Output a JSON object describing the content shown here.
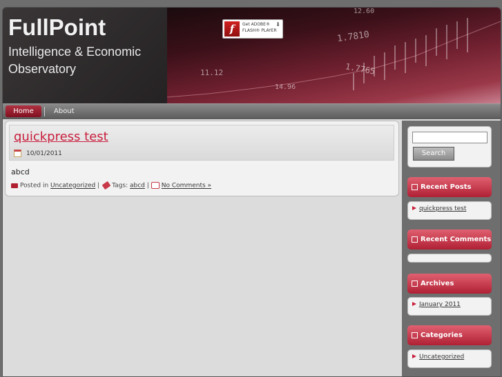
{
  "header": {
    "site_title": "FullPoint",
    "site_description": "Intelligence & Economic Observatory",
    "flash_badge": {
      "line1": "Get ADOBE®",
      "line2": "FLASH® PLAYER",
      "logo": "f"
    },
    "stock_numbers": [
      "1.7810",
      "11.12",
      "1.7765",
      "14.96",
      "12.60"
    ]
  },
  "nav": {
    "items": [
      {
        "label": "Home"
      },
      {
        "label": "About"
      }
    ]
  },
  "post": {
    "title": "quickpress test",
    "date": "10/01/2011",
    "body": "abcd",
    "meta": {
      "posted_in_label": "Posted in",
      "category": "Uncategorized",
      "tags_label": "Tags:",
      "tag": "abcd",
      "comments": "No Comments »"
    }
  },
  "sidebar": {
    "search_button": "Search",
    "search_value": "",
    "widgets": [
      {
        "title": "Recent Posts",
        "items": [
          "quickpress test"
        ]
      },
      {
        "title": "Recent Comments",
        "items": []
      },
      {
        "title": "Archives",
        "items": [
          "January 2011"
        ]
      },
      {
        "title": "Categories",
        "items": [
          "Uncategorized"
        ]
      }
    ]
  },
  "colors": {
    "accent": "#c81e3c",
    "widget_title": "#b02034",
    "nav_active": "#801020"
  }
}
